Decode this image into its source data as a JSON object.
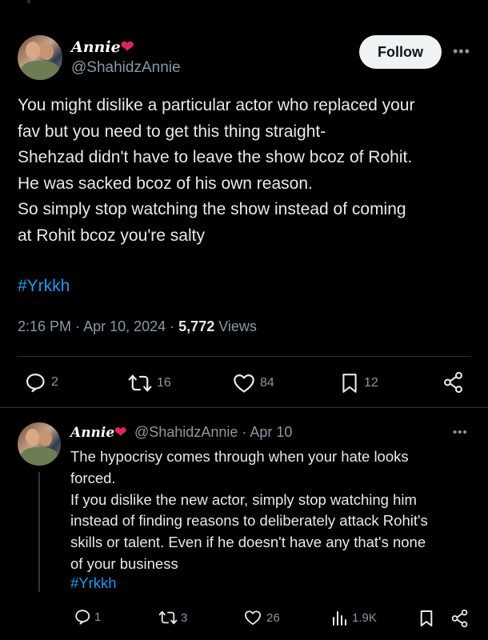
{
  "main_tweet": {
    "display_name": "Annie",
    "handle": "@ShahidzAnnie",
    "follow_label": "Follow",
    "text_lines": [
      "You might dislike a particular actor who replaced your",
      "fav but you need to get this thing straight-",
      "Shehzad didn't have to leave the show bcoz of Rohit.",
      "He was sacked bcoz of his own reason.",
      "So simply stop watching the show instead of coming",
      "at Rohit bcoz you're salty"
    ],
    "hashtag": "#Yrkkh",
    "time": "2:16 PM",
    "date": "Apr 10, 2024",
    "views_count": "5,772",
    "views_label": "Views",
    "replies": "2",
    "reposts": "16",
    "likes": "84",
    "bookmarks": "12"
  },
  "reply_tweet": {
    "display_name": "Annie",
    "handle": "@ShahidzAnnie",
    "date": "Apr 10",
    "text_lines": [
      "The hypocrisy comes through when your hate looks",
      "forced.",
      "If you dislike the new actor, simply stop watching him",
      "instead of finding reasons to deliberately attack Rohit's",
      "skills or talent. Even if he doesn't have any that's none",
      "of your business"
    ],
    "hashtag": "#Yrkkh",
    "replies": "1",
    "reposts": "3",
    "likes": "26",
    "views": "1.9K"
  },
  "icons": {
    "heart_emoji": "❤",
    "more": "•••"
  },
  "colors": {
    "background": "#000000",
    "text": "#e7e9ea",
    "muted": "#8b98a5",
    "link": "#1d9bf0",
    "heart": "#e0245e",
    "follow_bg": "#eff3f4"
  }
}
